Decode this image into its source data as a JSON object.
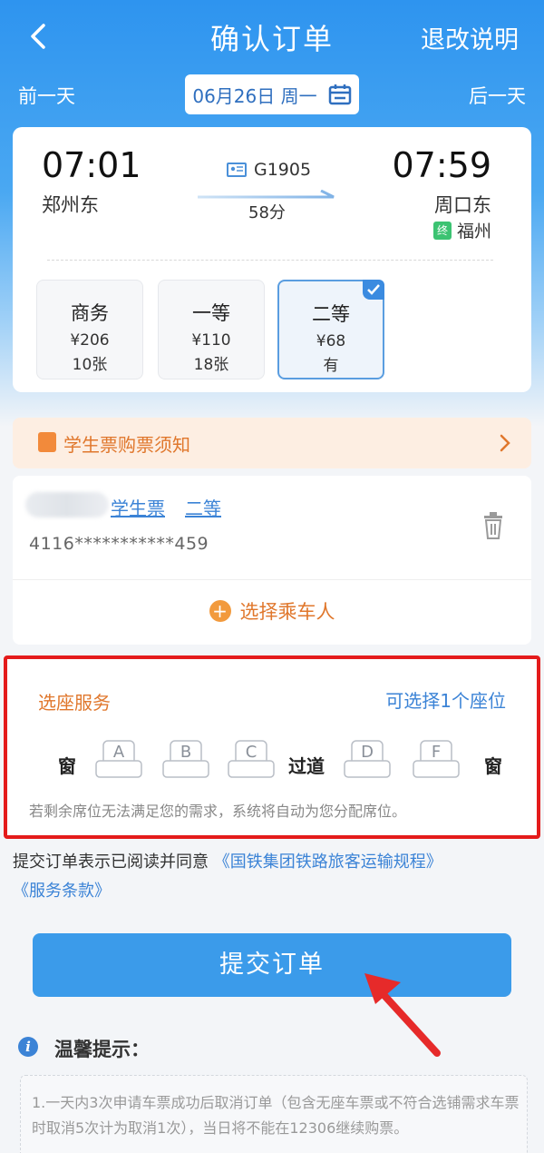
{
  "header": {
    "title": "确认订单",
    "policy_link": "退改说明",
    "prev_day": "前一天",
    "next_day": "后一天",
    "date": "06月26日 周一"
  },
  "train": {
    "departure_time": "07:01",
    "departure_station": "郑州东",
    "arrival_time": "07:59",
    "arrival_station": "周口东",
    "train_number": "G1905",
    "duration": "58分",
    "terminal_badge": "终",
    "terminal_station": "福州"
  },
  "seat_classes": [
    {
      "name": "商务",
      "price": "¥206",
      "count": "10张",
      "selected": false
    },
    {
      "name": "一等",
      "price": "¥110",
      "count": "18张",
      "selected": false
    },
    {
      "name": "二等",
      "price": "¥68",
      "count": "有",
      "selected": true
    }
  ],
  "student_notice": {
    "label": "学生票购票须知"
  },
  "passenger": {
    "ticket_type": "学生票",
    "seat_class": "二等",
    "id_number": "4116***********459",
    "choose_label": "选择乘车人"
  },
  "seat_service": {
    "title": "选座服务",
    "count_text": "可选择1个座位",
    "window_left": "窗",
    "window_right": "窗",
    "aisle": "过道",
    "seats": [
      "A",
      "B",
      "C",
      "D",
      "F"
    ],
    "note": "若剩余席位无法满足您的需求，系统将自动为您分配席位。"
  },
  "agreement": {
    "prefix": "提交订单表示已阅读并同意",
    "link1": "《国铁集团铁路旅客运输规程》",
    "link2": "《服务条款》"
  },
  "submit_label": "提交订单",
  "tips": {
    "title": "温馨提示：",
    "text": "1.一天内3次申请车票成功后取消订单（包含无座车票或不符合选铺需求车票时取消5次计为取消1次），当日将不能在12306继续购票。"
  },
  "colors": {
    "primary_blue": "#3b9bea",
    "orange": "#e0772c",
    "highlight_red": "#e41b1b"
  }
}
